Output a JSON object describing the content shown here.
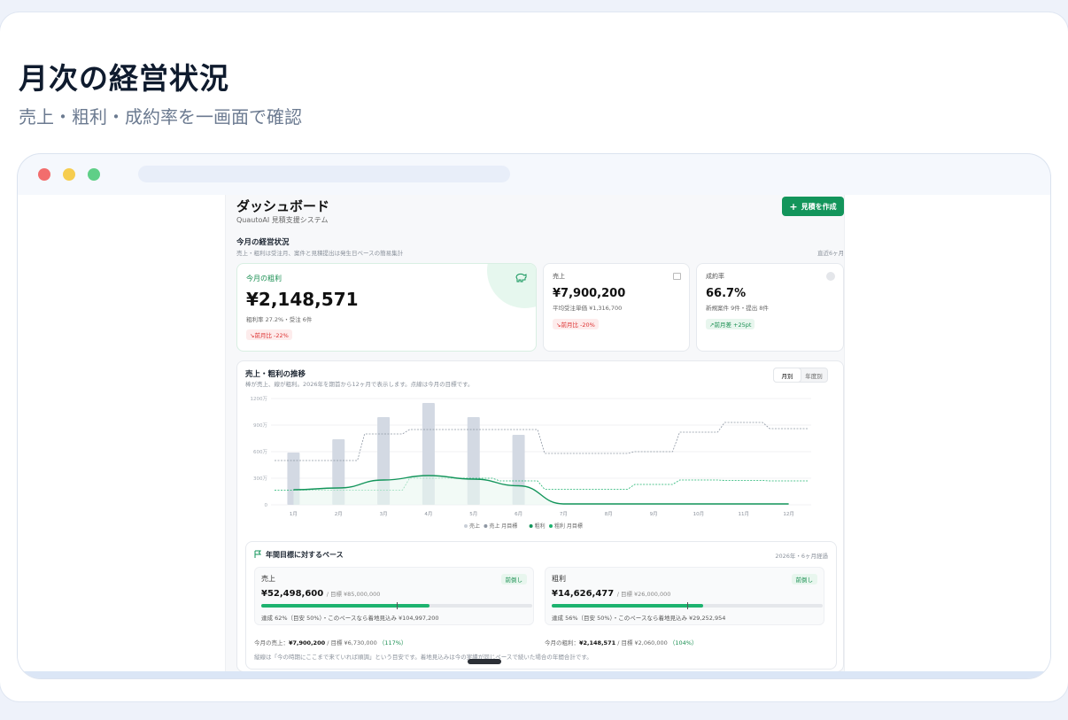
{
  "hero": {
    "title": "月次の経営状況",
    "subtitle": "売上・粗利・成約率を一画面で確認"
  },
  "colors": {
    "accent": "#13955b",
    "gross": "#13955b",
    "sales_bar": "#d3d9e3",
    "down": "#d33333",
    "up": "#1a8f52"
  },
  "dashboard": {
    "title": "ダッシュボード",
    "subtitle": "QuautoAI 見積支援システム",
    "new_button": "見積を作成",
    "new_button_icon": "plus-icon",
    "section_title": "今月の経営状況",
    "section_sub": "売上・粗利は受注月、案件と見積提出は発生日ベースの簡易集計",
    "section_range": "直近6ヶ月"
  },
  "kpis": {
    "gross": {
      "label": "今月の粗利",
      "value": "¥2,148,571",
      "detail": "粗利率 27.2%・受注 6件",
      "delta": "前月比 -22%",
      "icon": "piggy-bank-icon"
    },
    "sales": {
      "label": "売上",
      "value": "¥7,900,200",
      "detail": "平均受注単価 ¥1,316,700",
      "delta": "前月比 -20%",
      "icon": "calendar-icon"
    },
    "rate": {
      "label": "成約率",
      "value": "66.7%",
      "detail": "新規案件 9件・提出 8件",
      "delta": "前月差 +25pt",
      "icon": "circle-icon"
    }
  },
  "chart": {
    "title": "売上・粗利の推移",
    "subtitle": "棒が売上、線が粗利。2026年を期首から12ヶ月で表示します。点線は今月の目標です。",
    "toggle": [
      "月別",
      "年度別"
    ],
    "legend": [
      "売上",
      "売上 月目標",
      "粗利",
      "粗利 月目標"
    ]
  },
  "chart_data": {
    "type": "bar",
    "categories": [
      "1月",
      "2月",
      "3月",
      "4月",
      "5月",
      "6月",
      "7月",
      "8月",
      "9月",
      "10月",
      "11月",
      "12月"
    ],
    "y_ticks": [
      "1200万",
      "900万",
      "600万",
      "300万",
      "0"
    ],
    "ylim": [
      0,
      1200
    ],
    "series": [
      {
        "name": "売上",
        "type": "bar",
        "values": [
          590,
          740,
          990,
          1150,
          990,
          790,
          null,
          null,
          null,
          null,
          null,
          null
        ]
      },
      {
        "name": "売上 月目標",
        "type": "step-dashed",
        "values": [
          500,
          500,
          800,
          850,
          850,
          850,
          580,
          580,
          600,
          820,
          930,
          860
        ]
      },
      {
        "name": "粗利",
        "type": "line",
        "values": [
          170,
          190,
          280,
          330,
          290,
          215,
          10,
          10,
          10,
          10,
          10,
          10
        ]
      },
      {
        "name": "粗利 月目標",
        "type": "step-dashed",
        "values": [
          165,
          165,
          165,
          300,
          300,
          270,
          175,
          175,
          230,
          280,
          275,
          270
        ]
      }
    ]
  },
  "pace": {
    "title": "年間目標に対するペース",
    "meta": "2026年・6ヶ月経過",
    "sales": {
      "label": "売上",
      "badge": "前倒し",
      "value": "¥52,498,600",
      "target": "/ 目標 ¥85,000,000",
      "progress": 0.62,
      "marker": 0.5,
      "note": "達成 62%（目安 50%）・このペースなら着地見込み ¥104,997,200"
    },
    "gross": {
      "label": "粗利",
      "badge": "前倒し",
      "value": "¥14,626,477",
      "target": "/ 目標 ¥26,000,000",
      "progress": 0.56,
      "marker": 0.5,
      "note": "達成 56%（目安 50%）・このペースなら着地見込み ¥29,252,954"
    },
    "month_sales": {
      "label": "今月の売上：",
      "value": "¥7,900,200",
      "target": "/ 目標 ¥6,730,000",
      "pct": "（117%）"
    },
    "month_gross": {
      "label": "今月の粗利：",
      "value": "¥2,148,571",
      "target": "/ 目標 ¥2,060,000",
      "pct": "（104%）"
    },
    "footnote": "縦線は「今の時期にここまで来ていれば順調」という目安です。着地見込みは今の実績が同じペースで続いた場合の年間合計です。"
  }
}
